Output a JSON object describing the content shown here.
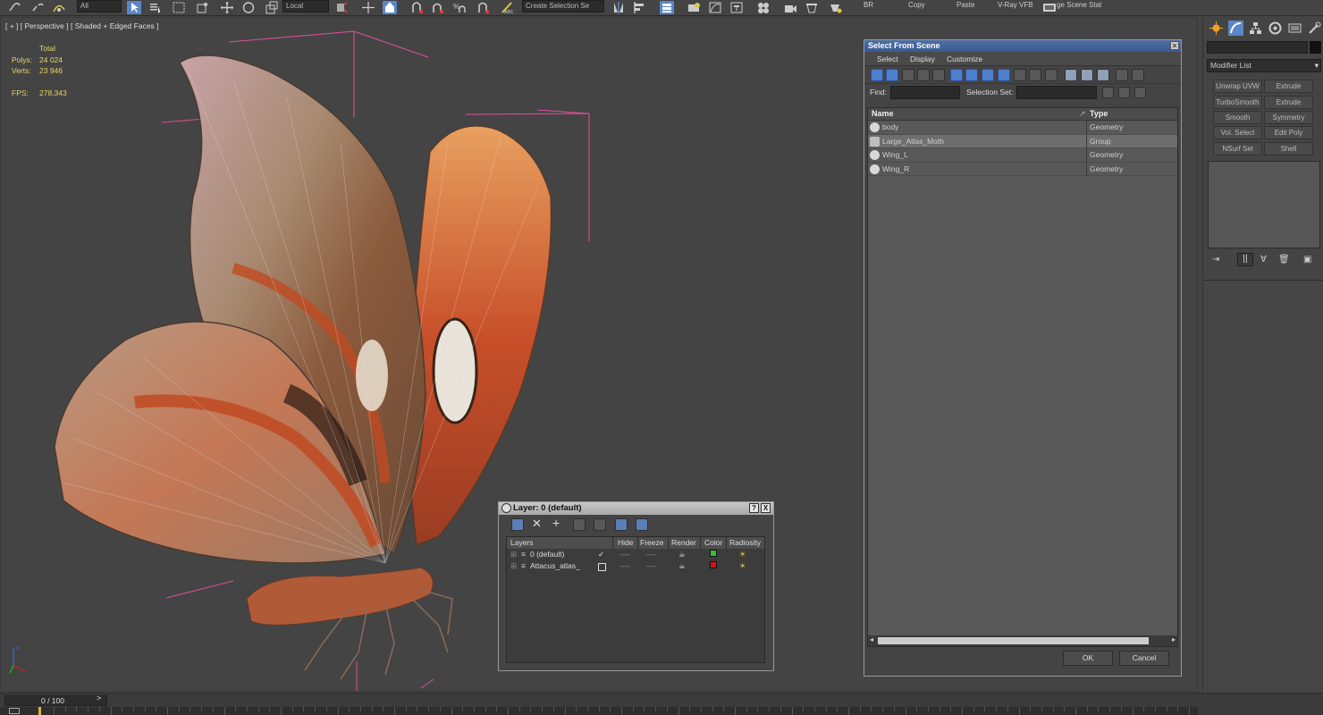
{
  "toolbar": {
    "filter_select": "All",
    "ref_coord_select": "Local",
    "selection_set_select": "Create Selection Se",
    "br_label": "BR",
    "copy_label": "Copy",
    "paste_label": "Paste",
    "vray_label": "V-Ray VFB",
    "scene_state_label": "ge Scene Stat"
  },
  "viewport": {
    "label": "[ + ] [ Perspective ] [ Shaded + Edged Faces ]",
    "stats": {
      "total_label": "Total",
      "polys_label": "Polys:",
      "polys_value": "24 024",
      "verts_label": "Verts:",
      "verts_value": "23 946",
      "fps_label": "FPS:",
      "fps_value": "278,343"
    }
  },
  "select_from_scene": {
    "title": "Select From Scene",
    "menu": [
      "Select",
      "Display",
      "Customize"
    ],
    "find_label": "Find:",
    "find_value": "",
    "selection_set_label": "Selection Set:",
    "selection_set_value": "",
    "columns": {
      "name": "Name",
      "type": "Type"
    },
    "rows": [
      {
        "name": "body",
        "type": "Geometry"
      },
      {
        "name": "Large_Atlas_Moth",
        "type": "Group"
      },
      {
        "name": "Wing_L",
        "type": "Geometry"
      },
      {
        "name": "Wing_R",
        "type": "Geometry"
      }
    ],
    "ok_label": "OK",
    "cancel_label": "Cancel"
  },
  "layer_dialog": {
    "title": "Layer: 0 (default)",
    "help_label": "?",
    "close_label": "X",
    "columns": [
      "Layers",
      "Hide",
      "Freeze",
      "Render",
      "Color",
      "Radiosity"
    ],
    "layers": [
      {
        "name": "0 (default)",
        "hide": "----",
        "freeze": "----",
        "color": "#35c13a",
        "active": true
      },
      {
        "name": "Attacus_atlas_",
        "hide": "----",
        "freeze": "----",
        "color": "#d0151b",
        "active": false
      }
    ]
  },
  "command_panel": {
    "modifier_list": "Modifier List",
    "buttons": [
      [
        "Unwrap UVW",
        "Extrude"
      ],
      [
        "TurboSmooth",
        "Extrude"
      ],
      [
        "Smooth",
        "Symmetry"
      ],
      [
        "Vol. Select",
        "Edit Poly"
      ],
      [
        "NSurf Sel",
        "Shell"
      ]
    ]
  },
  "timeline": {
    "frame_label": "0 / 100",
    "next_label": ">"
  },
  "colors": {
    "selection_blue": "#4f7fcf",
    "stats_yellow": "#e8d36a",
    "bounding_box_pink": "#e04f9b"
  }
}
